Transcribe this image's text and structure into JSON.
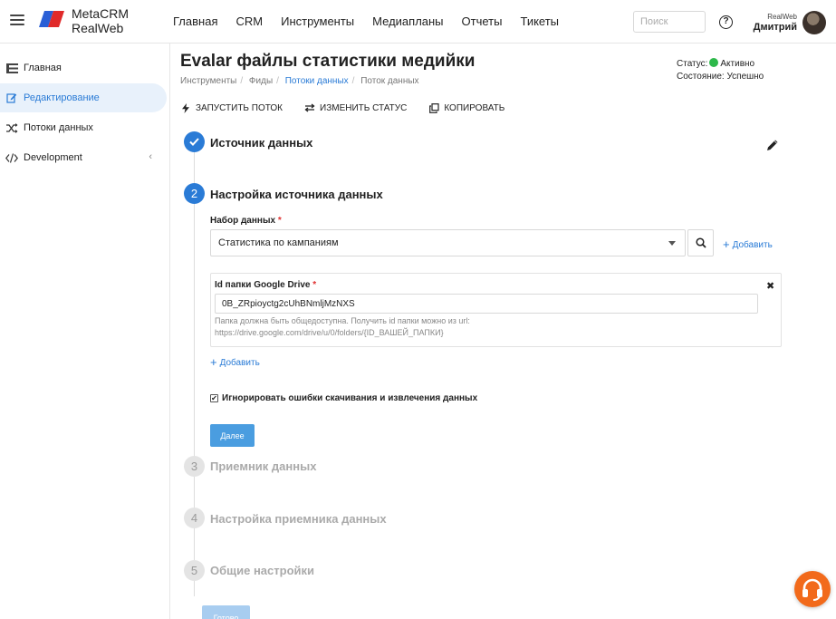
{
  "app": {
    "brand_line1": "MetaCRM",
    "brand_line2": "RealWeb"
  },
  "nav": [
    "Главная",
    "CRM",
    "Инструменты",
    "Медиапланы",
    "Отчеты",
    "Тикеты"
  ],
  "search": {
    "placeholder": "Поиск"
  },
  "user": {
    "org": "RealWeb",
    "name": "Дмитрий"
  },
  "sidebar": {
    "items": [
      {
        "label": "Главная",
        "icon": "list-icon",
        "active": false
      },
      {
        "label": "Редактирование",
        "icon": "edit-icon",
        "active": true
      },
      {
        "label": "Потоки данных",
        "icon": "shuffle-icon",
        "active": false
      },
      {
        "label": "Development",
        "icon": "code-icon",
        "active": false
      }
    ]
  },
  "page": {
    "title": "Evalar файлы статистики медийки",
    "breadcrumbs": [
      "Инструменты",
      "Фиды",
      "Потоки данных",
      "Поток данных"
    ],
    "status_label": "Статус:",
    "status_value": "Активно",
    "state_label": "Состояние:",
    "state_value": "Успешно"
  },
  "actions": {
    "run": "ЗАПУСТИТЬ ПОТОК",
    "change_status": "ИЗМЕНИТЬ СТАТУС",
    "copy": "КОПИРОВАТЬ"
  },
  "steps": [
    {
      "num": "1",
      "title": "Источник данных",
      "state": "done"
    },
    {
      "num": "2",
      "title": "Настройка источника данных",
      "state": "current"
    },
    {
      "num": "3",
      "title": "Приемник данных",
      "state": "todo"
    },
    {
      "num": "4",
      "title": "Настройка приемника данных",
      "state": "todo"
    },
    {
      "num": "5",
      "title": "Общие настройки",
      "state": "todo"
    }
  ],
  "form": {
    "dataset_label": "Набор данных",
    "dataset_value": "Статистика по кампаниям",
    "add_label": "Добавить",
    "drive_label": "Id папки Google Drive",
    "drive_value": "0B_ZRpioyctg2cUhBNmljMzNXS",
    "drive_hint1": "Папка должна быть общедоступна. Получить id папки можно из url:",
    "drive_hint2": "https://drive.google.com/drive/u/0/folders/{ID_ВАШЕЙ_ПАПКИ}",
    "add_folder_label": "Добавить",
    "ignore_errors_label": "Игнорировать ошибки скачивания и извлечения данных",
    "ignore_errors_checked": true,
    "next_button": "Далее",
    "done_button": "Готово"
  },
  "colors": {
    "accent": "#2a7bd6",
    "status_active": "#2db84a",
    "fab": "#f26a1b"
  }
}
